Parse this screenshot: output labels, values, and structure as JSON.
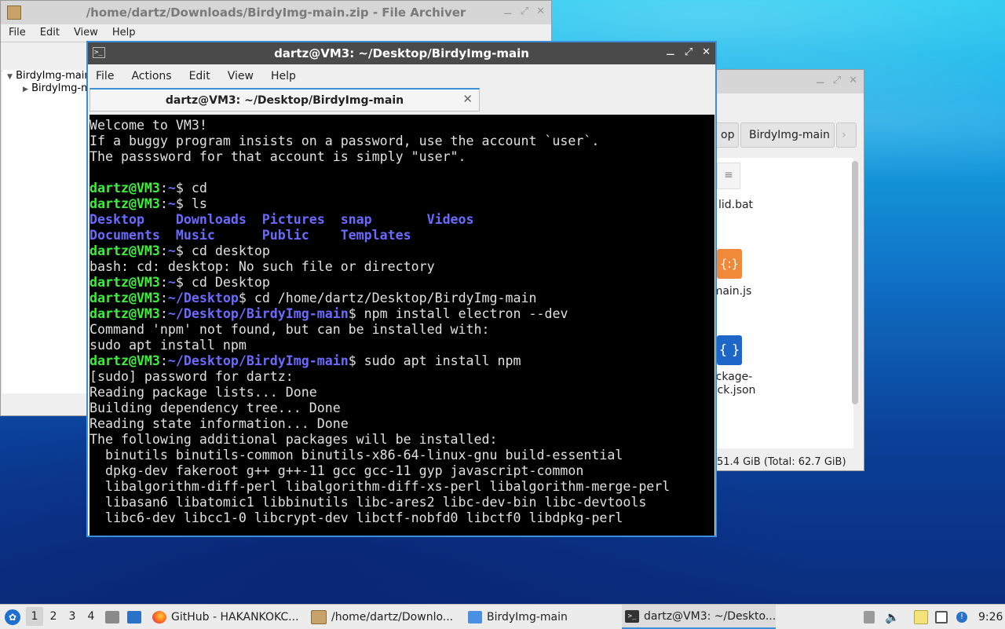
{
  "archiver": {
    "title": "/home/dartz/Downloads/BirdyImg-main.zip - File Archiver",
    "menu": [
      "File",
      "Edit",
      "View",
      "Help"
    ],
    "tree": [
      "BirdyImg-main",
      "BirdyImg-m"
    ]
  },
  "filemgr": {
    "path_partial": "op",
    "path_current": "BirdyImg-main",
    "items": [
      "lid.bat",
      "main.js",
      "ckage-",
      "ck.json"
    ],
    "status": "51.4 GiB (Total: 62.7 GiB)"
  },
  "terminal": {
    "title": "dartz@VM3: ~/Desktop/BirdyImg-main",
    "menu": [
      "File",
      "Actions",
      "Edit",
      "View",
      "Help"
    ],
    "tab_title": "dartz@VM3: ~/Desktop/BirdyImg-main",
    "lines": [
      [
        [
          "Welcome to VM3!",
          "t"
        ]
      ],
      [
        [
          "If a buggy program insists on a password, use the account `user`.",
          "t"
        ]
      ],
      [
        [
          "The passsword for that account is simply \"user\".",
          "t"
        ]
      ],
      [
        [
          "",
          "t"
        ]
      ],
      [
        [
          "dartz@VM3",
          "pu"
        ],
        [
          ":",
          "t"
        ],
        [
          "~",
          "pp"
        ],
        [
          "$ cd",
          "t"
        ]
      ],
      [
        [
          "dartz@VM3",
          "pu"
        ],
        [
          ":",
          "t"
        ],
        [
          "~",
          "pp"
        ],
        [
          "$ ls",
          "t"
        ]
      ],
      [
        [
          "Desktop    Downloads  Pictures  snap       Videos",
          "dir"
        ]
      ],
      [
        [
          "Documents  Music      Public    Templates",
          "dir"
        ]
      ],
      [
        [
          "dartz@VM3",
          "pu"
        ],
        [
          ":",
          "t"
        ],
        [
          "~",
          "pp"
        ],
        [
          "$ cd desktop",
          "t"
        ]
      ],
      [
        [
          "bash: cd: desktop: No such file or directory",
          "t"
        ]
      ],
      [
        [
          "dartz@VM3",
          "pu"
        ],
        [
          ":",
          "t"
        ],
        [
          "~",
          "pp"
        ],
        [
          "$ cd Desktop",
          "t"
        ]
      ],
      [
        [
          "dartz@VM3",
          "pu"
        ],
        [
          ":",
          "t"
        ],
        [
          "~/Desktop",
          "pp"
        ],
        [
          "$ cd /home/dartz/Desktop/BirdyImg-main",
          "t"
        ]
      ],
      [
        [
          "dartz@VM3",
          "pu"
        ],
        [
          ":",
          "t"
        ],
        [
          "~/Desktop/BirdyImg-main",
          "pp"
        ],
        [
          "$ npm install electron --dev",
          "t"
        ]
      ],
      [
        [
          "Command 'npm' not found, but can be installed with:",
          "t"
        ]
      ],
      [
        [
          "sudo apt install npm",
          "t"
        ]
      ],
      [
        [
          "dartz@VM3",
          "pu"
        ],
        [
          ":",
          "t"
        ],
        [
          "~/Desktop/BirdyImg-main",
          "pp"
        ],
        [
          "$ sudo apt install npm",
          "t"
        ]
      ],
      [
        [
          "[sudo] password for dartz:",
          "t"
        ]
      ],
      [
        [
          "Reading package lists... Done",
          "t"
        ]
      ],
      [
        [
          "Building dependency tree... Done",
          "t"
        ]
      ],
      [
        [
          "Reading state information... Done",
          "t"
        ]
      ],
      [
        [
          "The following additional packages will be installed:",
          "t"
        ]
      ],
      [
        [
          "  binutils binutils-common binutils-x86-64-linux-gnu build-essential",
          "t"
        ]
      ],
      [
        [
          "  dpkg-dev fakeroot g++ g++-11 gcc gcc-11 gyp javascript-common",
          "t"
        ]
      ],
      [
        [
          "  libalgorithm-diff-perl libalgorithm-diff-xs-perl libalgorithm-merge-perl",
          "t"
        ]
      ],
      [
        [
          "  libasan6 libatomic1 libbinutils libc-ares2 libc-dev-bin libc-devtools",
          "t"
        ]
      ],
      [
        [
          "  libc6-dev libcc1-0 libcrypt-dev libctf-nobfd0 libctf0 libdpkg-perl",
          "t"
        ]
      ]
    ]
  },
  "taskbar": {
    "workspaces": [
      "1",
      "2",
      "3",
      "4"
    ],
    "tasks": [
      {
        "label": "GitHub - HAKANKOKC...",
        "icon": "firefox-icon"
      },
      {
        "label": "/home/dartz/Downlo...",
        "icon": "archive-icon"
      },
      {
        "label": "BirdyImg-main",
        "icon": "folder-icon"
      },
      {
        "label": "dartz@VM3: ~/Deskto...",
        "icon": "terminal-icon"
      }
    ],
    "clock": "9:26"
  }
}
